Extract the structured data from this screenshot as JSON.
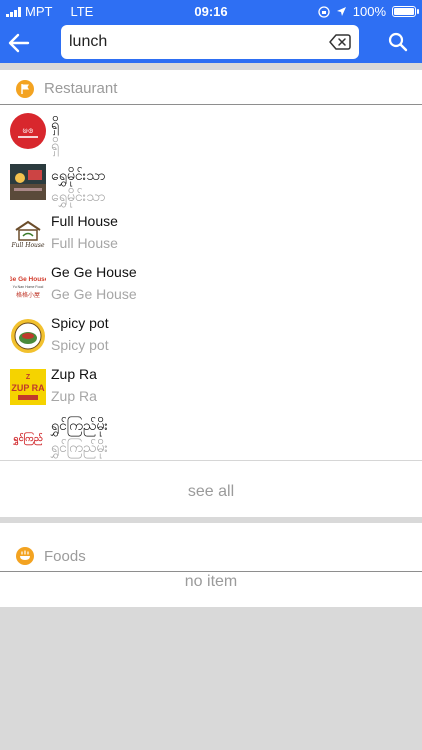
{
  "status_bar": {
    "carrier": "MPT",
    "network": "LTE",
    "time": "09:16",
    "battery": "100%"
  },
  "search": {
    "value": "lunch",
    "placeholder": ""
  },
  "colors": {
    "header_bg": "#2e6ff3",
    "badge": "#f3a321"
  },
  "sections": {
    "restaurant": {
      "title": "Restaurant",
      "icon": "flag-icon",
      "items": [
        {
          "title": "ရှိ",
          "subtitle": "ရှိ",
          "logo": "restaurant-logo-red"
        },
        {
          "title": "ရွှေမိုင်းသာ",
          "subtitle": "ရွှေမိုင်းသာ",
          "logo": "restaurant-logo-photo"
        },
        {
          "title": "Full House",
          "subtitle": "Full House",
          "logo": "restaurant-logo-fullhouse"
        },
        {
          "title": "Ge Ge House",
          "subtitle": "Ge Ge House",
          "logo": "restaurant-logo-gege"
        },
        {
          "title": "Spicy pot",
          "subtitle": "Spicy pot",
          "logo": "restaurant-logo-spicypot"
        },
        {
          "title": "Zup Ra",
          "subtitle": "Zup Ra",
          "logo": "restaurant-logo-zupra"
        },
        {
          "title": "ရွှင်ကြည်မိုး",
          "subtitle": "ရွှင်ကြည်မိုး",
          "logo": "restaurant-logo-red-text"
        }
      ],
      "see_all": "see all"
    },
    "foods": {
      "title": "Foods",
      "icon": "food-icon",
      "empty_text": "no item"
    }
  }
}
